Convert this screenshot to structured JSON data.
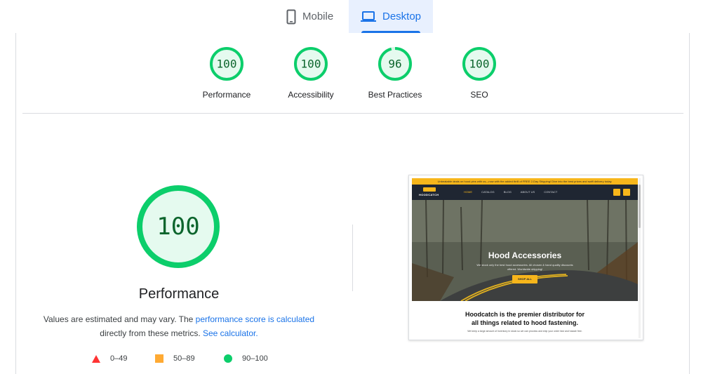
{
  "tabs": [
    {
      "label": "Mobile",
      "icon": "smartphone-icon",
      "active": false
    },
    {
      "label": "Desktop",
      "icon": "laptop-icon",
      "active": true
    }
  ],
  "categories": [
    {
      "score": "100",
      "label": "Performance",
      "value": 100
    },
    {
      "score": "100",
      "label": "Accessibility",
      "value": 100
    },
    {
      "score": "96",
      "label": "Best Practices",
      "value": 96
    },
    {
      "score": "100",
      "label": "SEO",
      "value": 100
    }
  ],
  "performance": {
    "score": "100",
    "value": 100,
    "title": "Performance",
    "desc_prefix": "Values are estimated and may vary. The ",
    "desc_link1": "performance score is calculated",
    "desc_middle": "directly from these metrics. ",
    "desc_link2": "See calculator."
  },
  "legend": [
    {
      "range": "0–49",
      "shape": "triangle",
      "color": "#ff3333"
    },
    {
      "range": "50–89",
      "shape": "square",
      "color": "#ffaa33"
    },
    {
      "range": "90–100",
      "shape": "circle",
      "color": "#0cce6b"
    }
  ],
  "screenshot": {
    "banner": "Unbeatable deals on hood pins with us—now with the added thrill of FREE 2-Day Shipping! Dive into the best prices and swift delivery today.",
    "logo": "HOODCATCH",
    "nav": [
      "HOME",
      "CATALOG",
      "BLOG",
      "ABOUT US",
      "CONTACT"
    ],
    "hero_title": "Hood Accessories",
    "hero_sub": "We stock only the best hood accessories. All chosen & hand quality discounts offered. Worldwide shipping!",
    "hero_button": "SHOP ALL",
    "tagline_1": "Hoodcatch is the premier distributor for",
    "tagline_2": "all things related to hood fastening.",
    "tagline_sub": "We keep a large amount of inventory in stock so we can process and ship your order fast and hassle free."
  },
  "colors": {
    "pass_green": "#0cce6b",
    "pass_fill": "#e5faef",
    "pass_text": "#0d652d",
    "accent_blue": "#1a73e8"
  }
}
